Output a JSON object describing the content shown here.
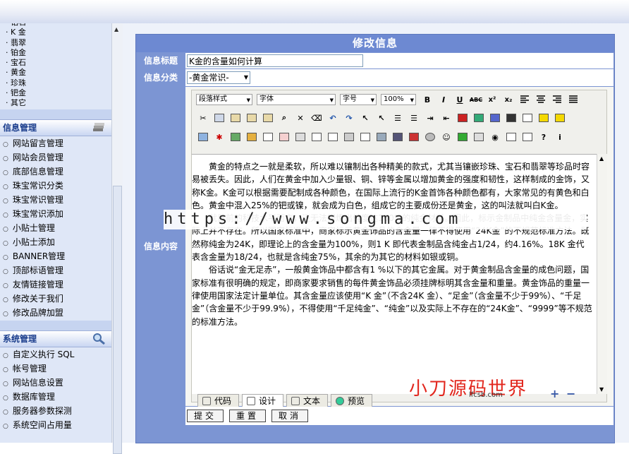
{
  "sidebar": {
    "category_items": [
      "钻石",
      "K 金",
      "翡翠",
      "铂金",
      "宝石",
      "黄金",
      "珍珠",
      "钯金",
      "其它"
    ],
    "info_section": {
      "title": "信息管理",
      "items": [
        "网站留言管理",
        "网站会员管理",
        "底部信息管理",
        "珠宝常识分类",
        "珠宝常识管理",
        "珠宝常识添加",
        "小贴士管理",
        "小贴士添加",
        "BANNER管理",
        "顶部标语管理",
        "友情链接管理",
        "修改关于我们",
        "修改品牌加盟"
      ]
    },
    "system_section": {
      "title": "系统管理",
      "items": [
        "自定义执行 SQL",
        "帐号管理",
        "网站信息设置",
        "数据库管理",
        "服务器参数探测",
        "系统空间占用量"
      ]
    }
  },
  "form": {
    "title": "修改信息",
    "title_label": "信息标题",
    "title_value": "K金的含量如何计算",
    "category_label": "信息分类",
    "category_value": "-黄金常识-",
    "content_label": "信息内容"
  },
  "editor": {
    "toolbar": {
      "paragraph_style": "段落样式",
      "font": "字体",
      "font_size": "字号",
      "zoom": "100%",
      "bold": "B",
      "italic": "I",
      "underline": "U",
      "strike": "ABC",
      "superscript": "x²",
      "subscript": "x₂"
    },
    "content": [
      "黄金的特点之一就是柔软，所以难以镶制出各种精美的款式，尤其当镶嵌珍珠、宝石和翡翠等珍品时容易被丢失。因此，人们在黄金中加入少量银、铜、锌等金属以增加黄金的强度和韧性，这样制成的金饰，又称K金。K金可以根据需要配制成各种颜色，在国际上流行的K金首饰各种颜色都有，大家常见的有黄色和白色。黄金中混入25%的钯或镍，就会成为白色，组成它的主要成份还是黄金，这的叫法就叫白K金。",
      "就目前的科技水平而言，还无法提炼出纯度达100%的纯金材料。因此，标示金制品中纯金含量金，实际上并不存在。所以国家标准中，商家标示黄金饰品的含金量一律不得使用“24K金”的不规范标准方法。既然称纯金为24K，即理论上的含金量为100%，则1 K 即代表金制品含纯金占1/24，约4.16%。18K 金代表含金量为18/24，也就是含纯金75%，其余的为其它的材料如银或铜。",
      "俗话说“金无足赤”，一般黄金饰品中都含有1 %以下的其它金属。对于黄金制品含金量的成色问题，国家标准有很明确的规定，即商家要求销售的每件黄金饰品必须挂牌标明其含金量和重量。黄金饰品的重量一律使用国家法定计量单位。其含金量应该使用“K 金”（不含24K 金）、“足金”（含金量不少于99%）、“千足金”（含金量不少于99.9%），不得使用“千足纯金”、“纯金”以及实际上不存在的“24K金”、“9999”等不规范的标准方法。"
    ],
    "tabs": [
      "代码",
      "设计",
      "文本",
      "预览"
    ],
    "active_tab": "设计"
  },
  "watermarks": {
    "url": "https://www.songma.com",
    "brand": "小刀源码世界",
    "brand_url": "lfcsb.com"
  },
  "actions": {
    "submit": "提交",
    "reset": "重置",
    "cancel": "取消"
  },
  "colors": {
    "header_blue": "#6d89d2",
    "label_blue": "#7c95d3",
    "sidebar_bg": "#dfe7f7",
    "brand_red": "#e2271e"
  }
}
